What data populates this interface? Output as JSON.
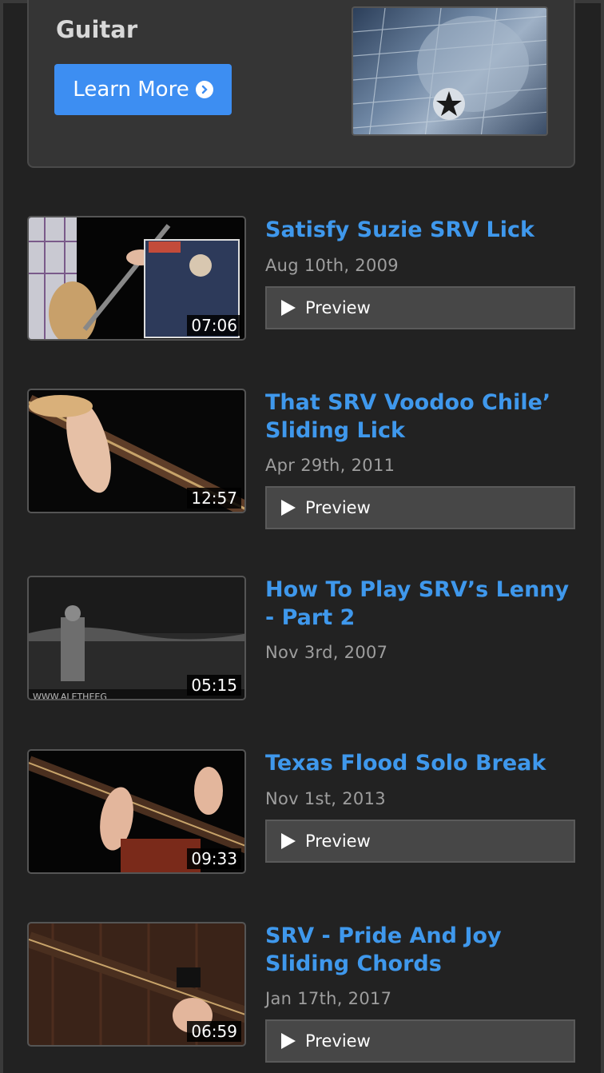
{
  "promo": {
    "title": "Guitar",
    "button_label": "Learn More"
  },
  "lessons": [
    {
      "title": "Satisfy Suzie SRV Lick",
      "date": "Aug 10th, 2009",
      "duration": "07:06",
      "preview": "Preview"
    },
    {
      "title": "That SRV Voodoo Chile’ Sliding Lick",
      "date": "Apr 29th, 2011",
      "duration": "12:57",
      "preview": "Preview"
    },
    {
      "title": "How To Play SRV’s Lenny - Part 2",
      "date": "Nov 3rd, 2007",
      "duration": "05:15"
    },
    {
      "title": "Texas Flood Solo Break",
      "date": "Nov 1st, 2013",
      "duration": "09:33",
      "preview": "Preview"
    },
    {
      "title": "SRV - Pride And Joy Sliding Chords",
      "date": "Jan 17th, 2017",
      "duration": "06:59",
      "preview": "Preview"
    }
  ],
  "colors": {
    "accent": "#3f98ec",
    "button": "#3d8ef2",
    "background": "#222222"
  }
}
